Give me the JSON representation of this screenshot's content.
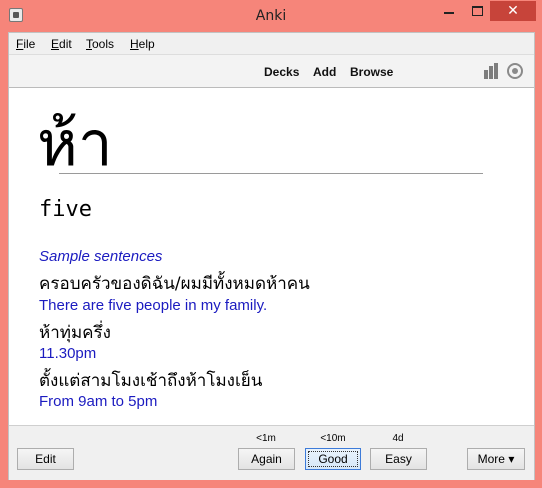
{
  "window": {
    "title": "Anki",
    "close_glyph": "✕",
    "colors": {
      "frame": "#f6857a",
      "close": "#c7443a"
    }
  },
  "menubar": {
    "file": {
      "accel": "F",
      "rest": "ile"
    },
    "edit": {
      "accel": "E",
      "rest": "dit"
    },
    "tools": {
      "accel": "T",
      "rest": "ools"
    },
    "help": {
      "accel": "H",
      "rest": "elp"
    }
  },
  "toolbar": {
    "decks": "Decks",
    "add": "Add",
    "browse": "Browse",
    "icons": [
      "stats-icon",
      "sync-icon"
    ]
  },
  "card": {
    "front": "ห้า",
    "back": "five",
    "sentences_heading": "Sample sentences",
    "sentences": [
      {
        "thai": "ครอบครัวของดิฉัน/ผมมีทั้งหมดห้าคน",
        "english": "There are five people in my family."
      },
      {
        "thai": "ห้าทุ่มครึ่ง",
        "english": "11.30pm"
      },
      {
        "thai": "ตั้งแต่สามโมงเช้าถึงห้าโมงเย็น",
        "english": "From 9am to 5pm"
      }
    ],
    "colors": {
      "sentence_english": "#1b1bc0"
    }
  },
  "bottombar": {
    "edit": "Edit",
    "again": {
      "label": "Again",
      "interval": "<1m"
    },
    "good": {
      "label": "Good",
      "interval": "<10m"
    },
    "easy": {
      "label": "Easy",
      "interval": "4d"
    },
    "more": "More ▾"
  }
}
